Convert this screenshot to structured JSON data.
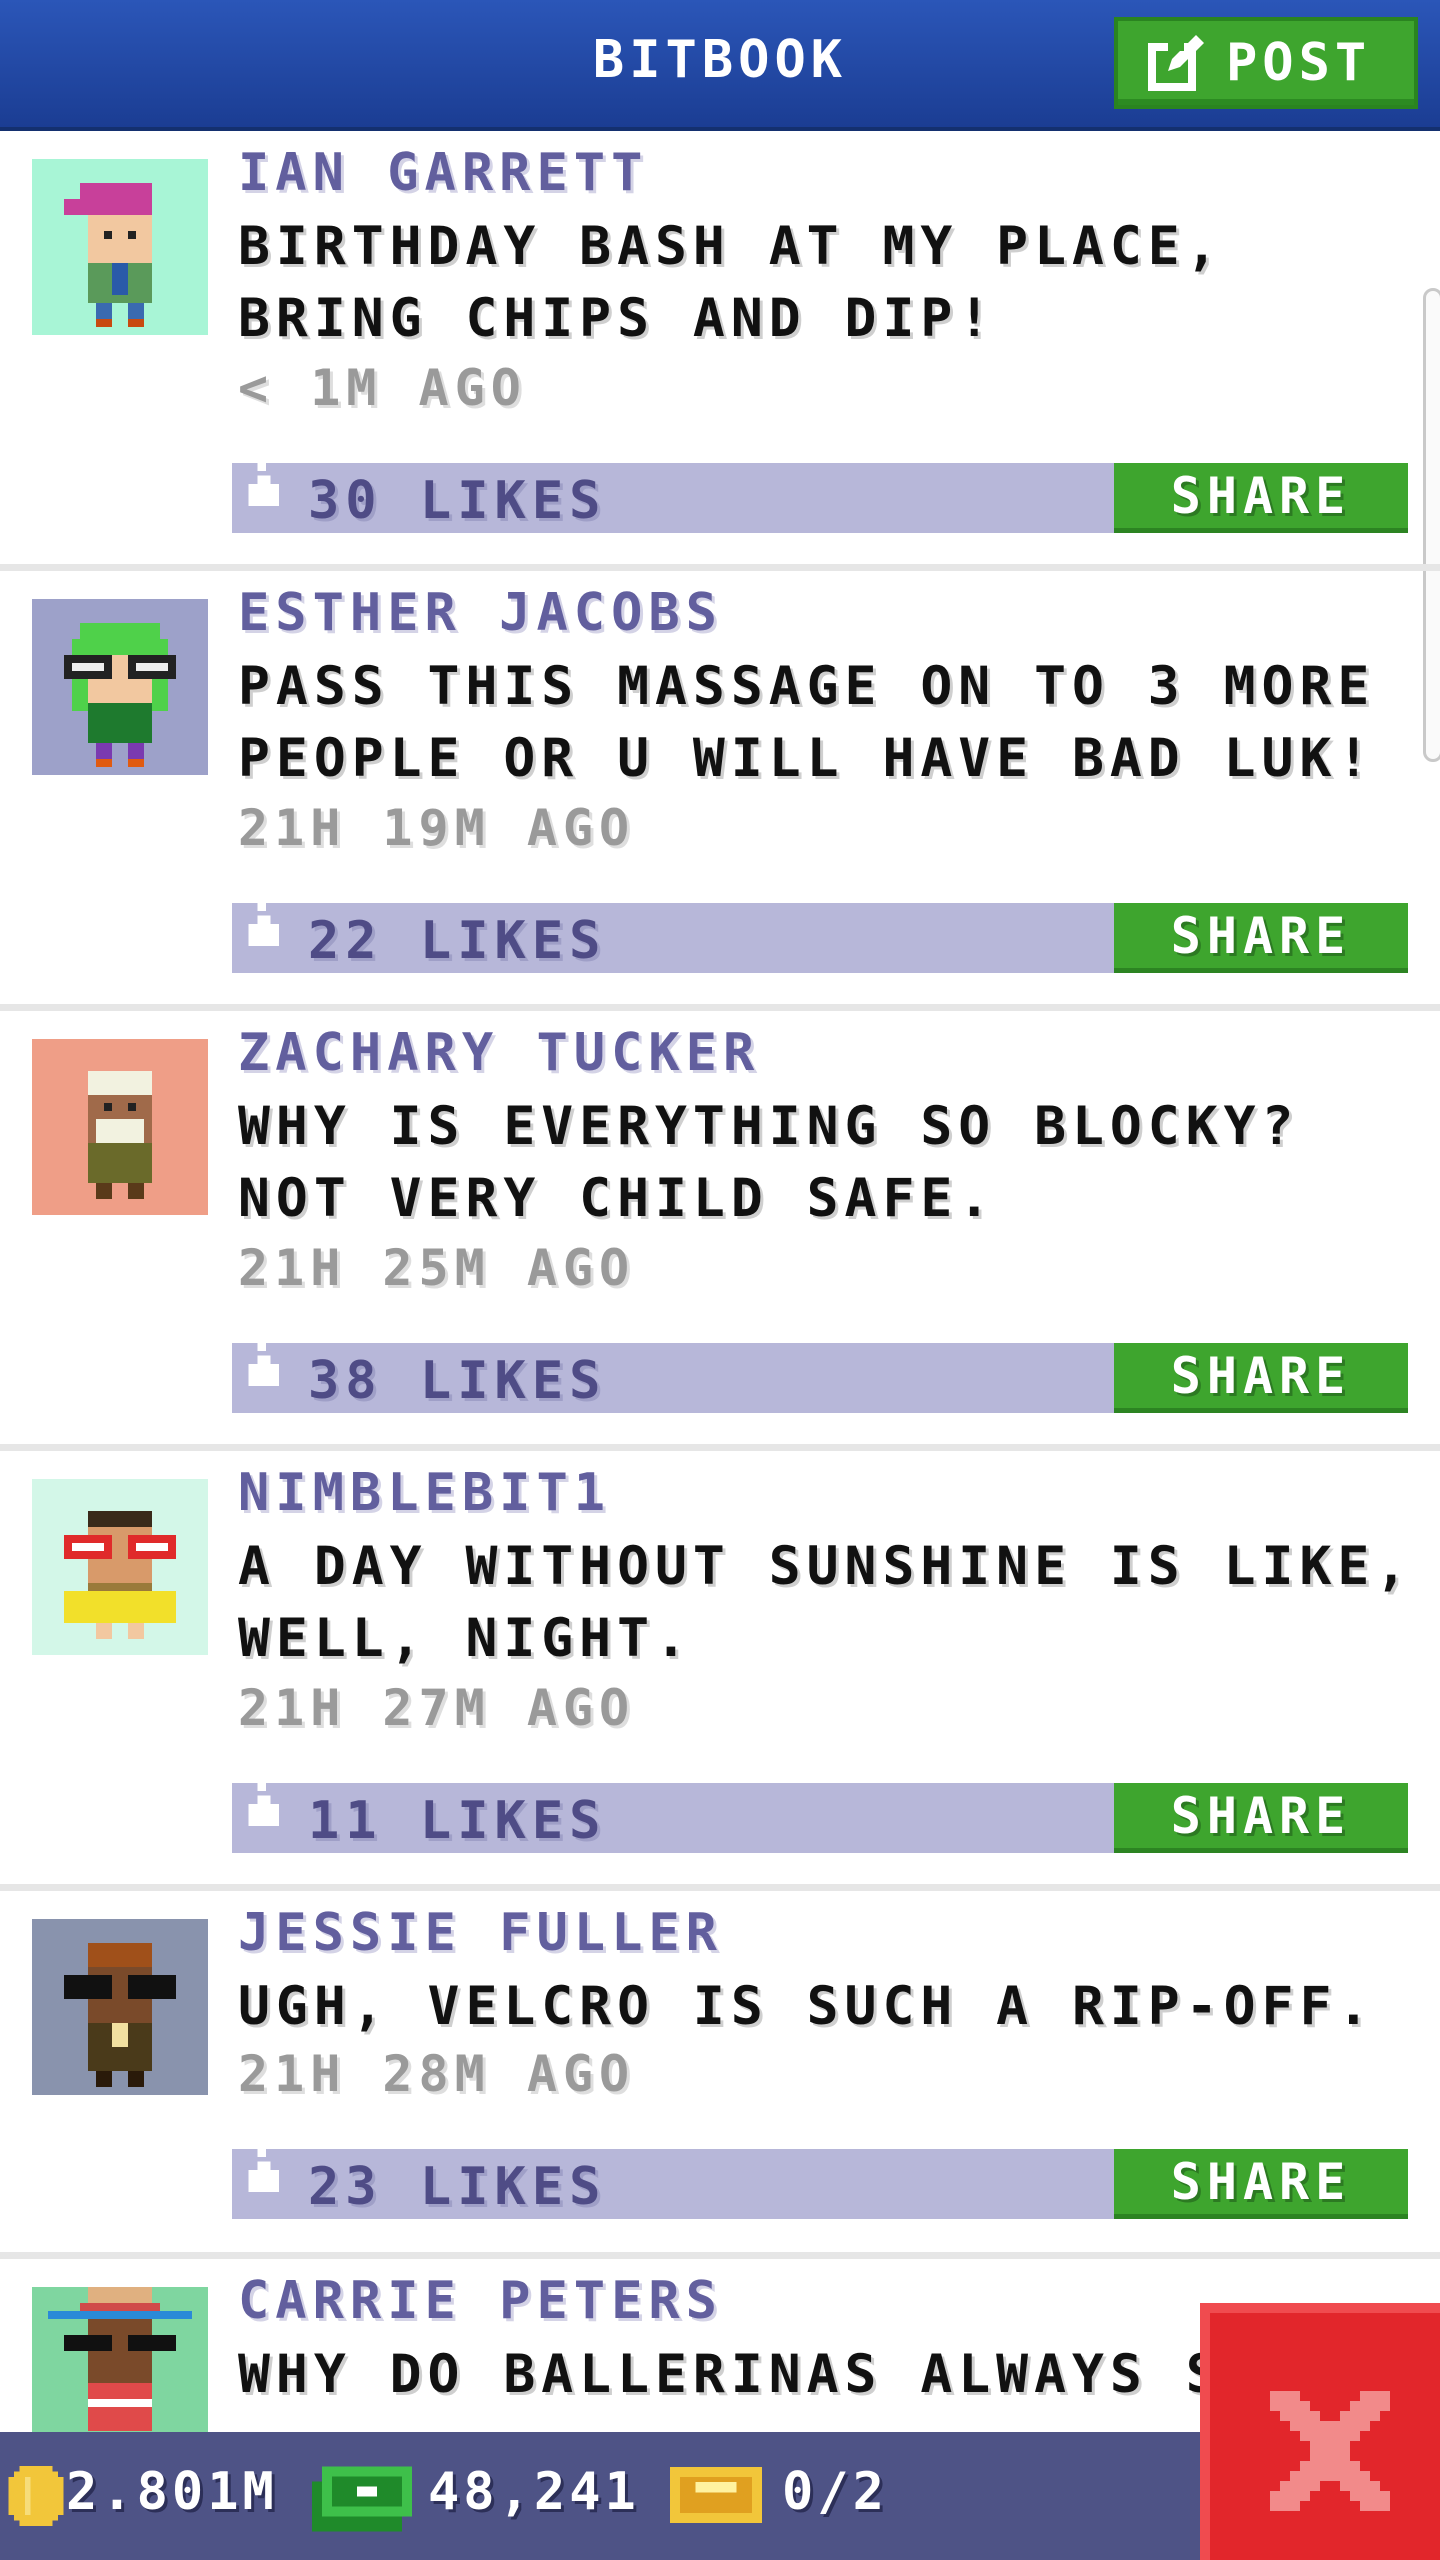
{
  "header": {
    "title": "BITBOOK",
    "post_label": "POST"
  },
  "posts": [
    {
      "author": "IAN GARRETT",
      "message": "BIRTHDAY BASH AT MY PLACE, BRING CHIPS AND DIP!",
      "time": "< 1M AGO",
      "likes": "30 LIKES",
      "share_label": "SHARE",
      "avatar_bg": "#a8f5d6"
    },
    {
      "author": "ESTHER JACOBS",
      "message": "PASS THIS MASSAGE ON TO 3 MORE PEOPLE OR U WILL HAVE BAD LUK!",
      "time": "21H 19M AGO",
      "likes": "22 LIKES",
      "share_label": "SHARE",
      "avatar_bg": "#9da1c9"
    },
    {
      "author": "ZACHARY TUCKER",
      "message": "WHY IS EVERYTHING SO BLOCKY? NOT VERY CHILD SAFE.",
      "time": "21H 25M AGO",
      "likes": "38 LIKES",
      "share_label": "SHARE",
      "avatar_bg": "#ef9e87"
    },
    {
      "author": "NIMBLEBIT1",
      "message": "A DAY WITHOUT SUNSHINE IS LIKE, WELL, NIGHT.",
      "time": "21H 27M AGO",
      "likes": "11 LIKES",
      "share_label": "SHARE",
      "avatar_bg": "#d3f7e8"
    },
    {
      "author": "JESSIE FULLER",
      "message": "UGH, VELCRO IS SUCH A RIP-OFF.",
      "time": "21H 28M AGO",
      "likes": "23 LIKES",
      "share_label": "SHARE",
      "avatar_bg": "#8993ad"
    },
    {
      "author": "CARRIE PETERS",
      "message": "WHY DO BALLERINAS ALWAYS S",
      "time": "",
      "likes": "",
      "share_label": "",
      "avatar_bg": "#7fd6a0"
    }
  ],
  "status": {
    "coins": "2.801M",
    "bux": "48,241",
    "tickets": "0/2"
  },
  "colors": {
    "header_blue": "#1f47a5",
    "share_green": "#3ea52e",
    "likes_bar": "#b7b7d9",
    "author_purple": "#625f9e",
    "close_red": "#e2262b"
  }
}
